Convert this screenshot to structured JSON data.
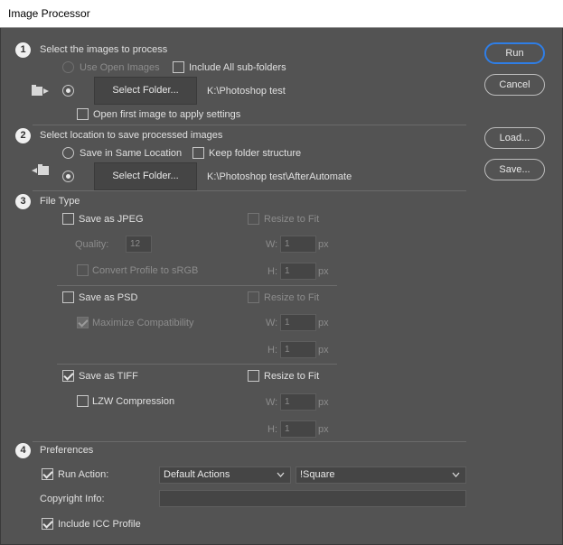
{
  "window": {
    "title": "Image Processor"
  },
  "sections": {
    "s1": {
      "num": "1",
      "title": "Select the images to process",
      "use_open": "Use Open Images",
      "include_sub": "Include All sub-folders",
      "select_folder": "Select Folder...",
      "path": "K:\\Photoshop test",
      "open_first": "Open first image to apply settings"
    },
    "s2": {
      "num": "2",
      "title": "Select location to save processed images",
      "same_location": "Save in Same Location",
      "keep_structure": "Keep folder structure",
      "select_folder": "Select Folder...",
      "path": "K:\\Photoshop test\\AfterAutomate"
    },
    "s3": {
      "num": "3",
      "title": "File Type",
      "jpeg": {
        "save": "Save as JPEG",
        "resize": "Resize to Fit",
        "quality_label": "Quality:",
        "quality": "12",
        "convert": "Convert Profile to sRGB",
        "w": "W:",
        "h": "H:",
        "wval": "1",
        "hval": "1",
        "unit": "px"
      },
      "psd": {
        "save": "Save as PSD",
        "resize": "Resize to Fit",
        "max": "Maximize Compatibility",
        "w": "W:",
        "h": "H:",
        "wval": "1",
        "hval": "1",
        "unit": "px"
      },
      "tiff": {
        "save": "Save as TIFF",
        "resize": "Resize to Fit",
        "lzw": "LZW Compression",
        "w": "W:",
        "h": "H:",
        "wval": "1",
        "hval": "1",
        "unit": "px"
      }
    },
    "s4": {
      "num": "4",
      "title": "Preferences",
      "run_action": "Run Action:",
      "action_set": "Default Actions",
      "action": "!Square",
      "copyright": "Copyright Info:",
      "copyright_value": "",
      "icc": "Include ICC Profile"
    }
  },
  "buttons": {
    "run": "Run",
    "cancel": "Cancel",
    "load": "Load...",
    "save": "Save..."
  },
  "colors": {
    "accent": "#2f7ee6",
    "panel": "#535353",
    "field": "#454545"
  }
}
